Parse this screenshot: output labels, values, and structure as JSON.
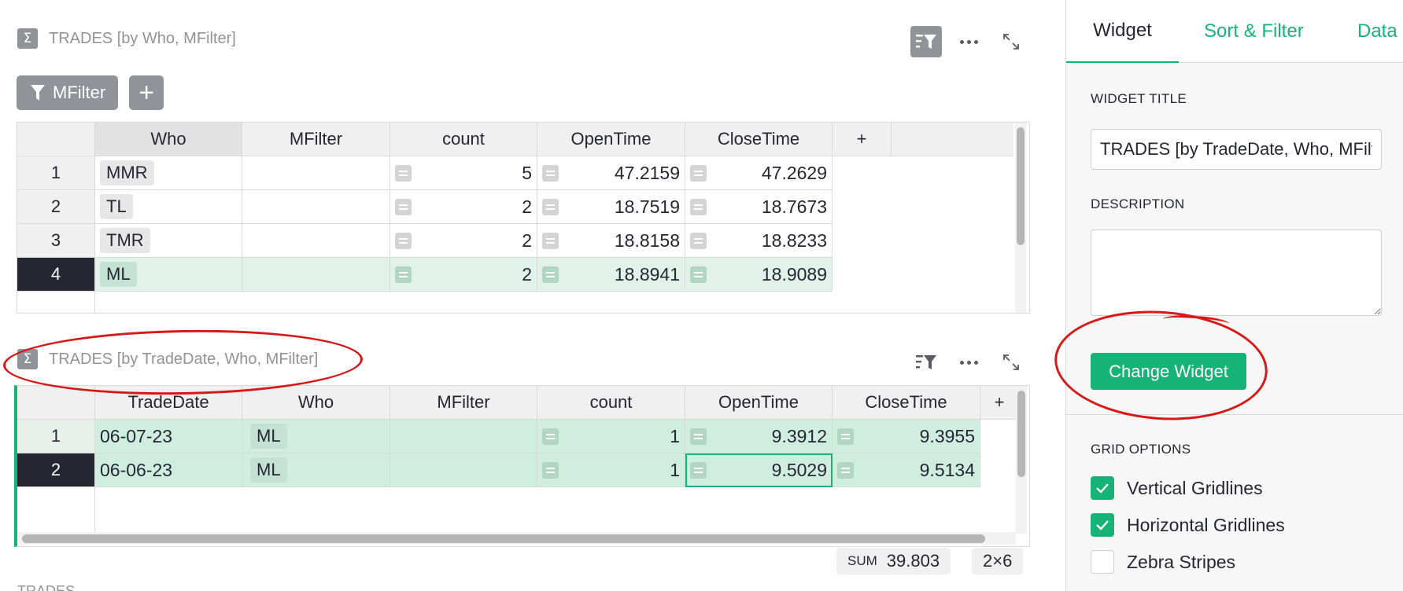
{
  "widget1": {
    "title": "TRADES [by Who, MFilter]",
    "filter_button_label": "MFilter",
    "add_filter_label": "+",
    "columns": [
      "Who",
      "MFilter",
      "count",
      "OpenTime",
      "CloseTime",
      "+"
    ],
    "rows": [
      {
        "n": "1",
        "who": "MMR",
        "mfilter": "",
        "count": "5",
        "open": "47.2159",
        "close": "47.2629"
      },
      {
        "n": "2",
        "who": "TL",
        "mfilter": "",
        "count": "2",
        "open": "18.7519",
        "close": "18.7673"
      },
      {
        "n": "3",
        "who": "TMR",
        "mfilter": "",
        "count": "2",
        "open": "18.8158",
        "close": "18.8233"
      },
      {
        "n": "4",
        "who": "ML",
        "mfilter": "",
        "count": "2",
        "open": "18.8941",
        "close": "18.9089"
      }
    ]
  },
  "widget2": {
    "title": "TRADES [by TradeDate, Who, MFilter]",
    "columns": [
      "TradeDate",
      "Who",
      "MFilter",
      "count",
      "OpenTime",
      "CloseTime",
      "+"
    ],
    "rows": [
      {
        "n": "1",
        "date": "06-07-23",
        "who": "ML",
        "mfilter": "",
        "count": "1",
        "open": "9.3912",
        "close": "9.3955"
      },
      {
        "n": "2",
        "date": "06-06-23",
        "who": "ML",
        "mfilter": "",
        "count": "1",
        "open": "9.5029",
        "close": "9.5134"
      }
    ],
    "selection_sum_label": "SUM",
    "selection_sum_value": "39.803",
    "selection_size": "2×6"
  },
  "widget3": {
    "title": "TRADES"
  },
  "panel": {
    "tabs": [
      "Widget",
      "Sort & Filter",
      "Data"
    ],
    "widget_title_label": "WIDGET TITLE",
    "widget_title_value": "TRADES [by TradeDate, Who, MFilter]",
    "description_label": "DESCRIPTION",
    "description_value": "",
    "change_widget_label": "Change Widget",
    "grid_options_label": "GRID OPTIONS",
    "options": [
      {
        "label": "Vertical Gridlines",
        "checked": true
      },
      {
        "label": "Horizontal Gridlines",
        "checked": true
      },
      {
        "label": "Zebra Stripes",
        "checked": false
      }
    ]
  },
  "colors": {
    "accent": "#16b378",
    "annotation": "#d71818",
    "muted": "#929299",
    "selected_row_bg": "#e0f2ea"
  }
}
